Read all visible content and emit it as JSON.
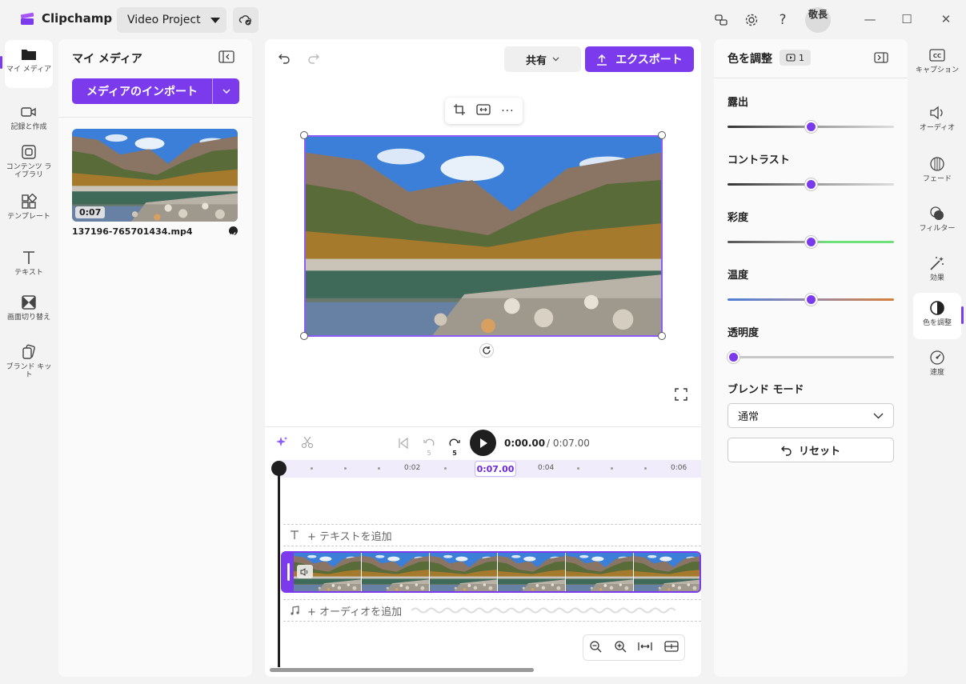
{
  "titlebar": {
    "app_name": "Clipchamp",
    "project_name": "Video Project",
    "avatar_text": "敬長"
  },
  "left_nav": [
    {
      "label": "マイ メディア",
      "icon": "folder-icon"
    },
    {
      "label": "記録と作成",
      "icon": "video-camera-icon"
    },
    {
      "label": "コンテンツ ライブラリ",
      "icon": "content-library-icon"
    },
    {
      "label": "テンプレート",
      "icon": "template-icon"
    },
    {
      "label": "テキスト",
      "icon": "text-icon"
    },
    {
      "label": "画面切り替え",
      "icon": "transition-icon"
    },
    {
      "label": "ブランド キット",
      "icon": "brand-kit-icon"
    }
  ],
  "media_panel": {
    "title": "マイ メディア",
    "import_label": "メディアのインポート",
    "file": {
      "name": "137196-765701434.mp4",
      "duration": "0:07"
    }
  },
  "editor": {
    "share_label": "共有",
    "export_label": "エクスポート",
    "time_current": "0:00.00",
    "time_total": "/ 0:07.00",
    "skip_back": "5",
    "skip_forward": "5",
    "ruler_labels": [
      "0:02",
      "0:04",
      "0:06"
    ],
    "playhead_badge": "0:07.00",
    "add_text": "+ テキストを追加",
    "add_audio": "+ オーディオを追加"
  },
  "properties": {
    "title": "色を調整",
    "clip_count": "1",
    "sliders": [
      {
        "label": "露出",
        "value": 0.5
      },
      {
        "label": "コントラスト",
        "value": 0.5
      },
      {
        "label": "彩度",
        "value": 0.5
      },
      {
        "label": "温度",
        "value": 0.5
      },
      {
        "label": "透明度",
        "value": 0.0
      }
    ],
    "blend_label": "ブレンド モード",
    "blend_value": "通常",
    "reset_label": "リセット"
  },
  "right_nav": [
    {
      "label": "キャプション",
      "icon": "captions-icon"
    },
    {
      "label": "オーディオ",
      "icon": "speaker-icon"
    },
    {
      "label": "フェード",
      "icon": "fade-icon"
    },
    {
      "label": "フィルター",
      "icon": "filter-icon"
    },
    {
      "label": "効果",
      "icon": "magic-wand-icon"
    },
    {
      "label": "色を調整",
      "icon": "color-adjust-icon"
    },
    {
      "label": "速度",
      "icon": "speedometer-icon"
    }
  ],
  "colors": {
    "accent": "#7c3aed",
    "accent_light": "#8b5cf6"
  }
}
